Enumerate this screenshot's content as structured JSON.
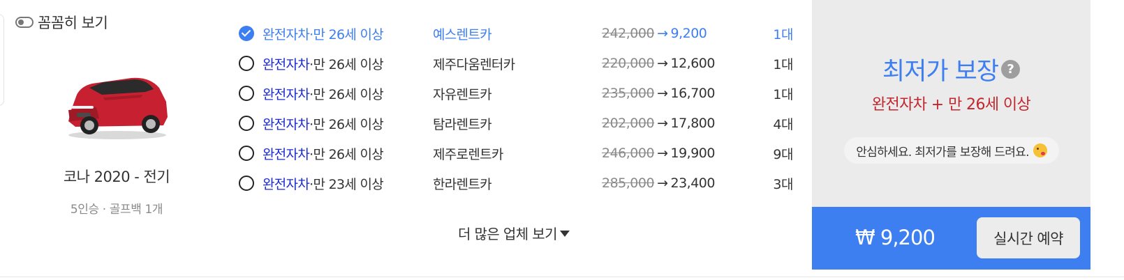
{
  "toggle": {
    "label": "꼼꼼히 보기",
    "icon": "toggle-off-icon"
  },
  "car": {
    "name": "코나 2020 - 전기",
    "spec": "5인승 · 골프백 1개",
    "image_icon": "red-suv-car-icon",
    "color": "#c62031"
  },
  "offers": [
    {
      "selected": true,
      "insurance_full": "완전자차",
      "insurance_age": "·만 26세 이상",
      "company": "예스렌트카",
      "old_price": "242,000",
      "new_price": "9,200",
      "count": "1대"
    },
    {
      "selected": false,
      "insurance_full": "완전자차",
      "insurance_age": "·만 26세 이상",
      "company": "제주다움렌터카",
      "old_price": "220,000",
      "new_price": "12,600",
      "count": "1대"
    },
    {
      "selected": false,
      "insurance_full": "완전자차",
      "insurance_age": "·만 26세 이상",
      "company": "자유렌트카",
      "old_price": "235,000",
      "new_price": "16,700",
      "count": "1대"
    },
    {
      "selected": false,
      "insurance_full": "완전자차",
      "insurance_age": "·만 26세 이상",
      "company": "탐라렌트카",
      "old_price": "202,000",
      "new_price": "17,800",
      "count": "4대"
    },
    {
      "selected": false,
      "insurance_full": "완전자차",
      "insurance_age": "·만 26세 이상",
      "company": "제주로렌트카",
      "old_price": "246,000",
      "new_price": "19,900",
      "count": "9대"
    },
    {
      "selected": false,
      "insurance_full": "완전자차",
      "insurance_age": "·만 23세 이상",
      "company": "한라렌트카",
      "old_price": "285,000",
      "new_price": "23,400",
      "count": "3대"
    }
  ],
  "arrow_symbol": "→",
  "more": {
    "label": "더 많은 업체 보기",
    "icon": "caret-down-icon"
  },
  "guarantee": {
    "title": "최저가 보장",
    "help_symbol": "?",
    "condition": "완전자차 + 만 26세 이상",
    "message": "안심하세요. 최저가를 보장해 드려요.",
    "emoji_icon": "kissing-face-icon"
  },
  "booking": {
    "total": "₩ 9,200",
    "button_label": "실시간 예약"
  },
  "colors": {
    "accent": "#3d7ef1",
    "insurance_blue": "#1c2bd4",
    "condition_red": "#c1272d",
    "side_bg": "#ebebeb"
  }
}
